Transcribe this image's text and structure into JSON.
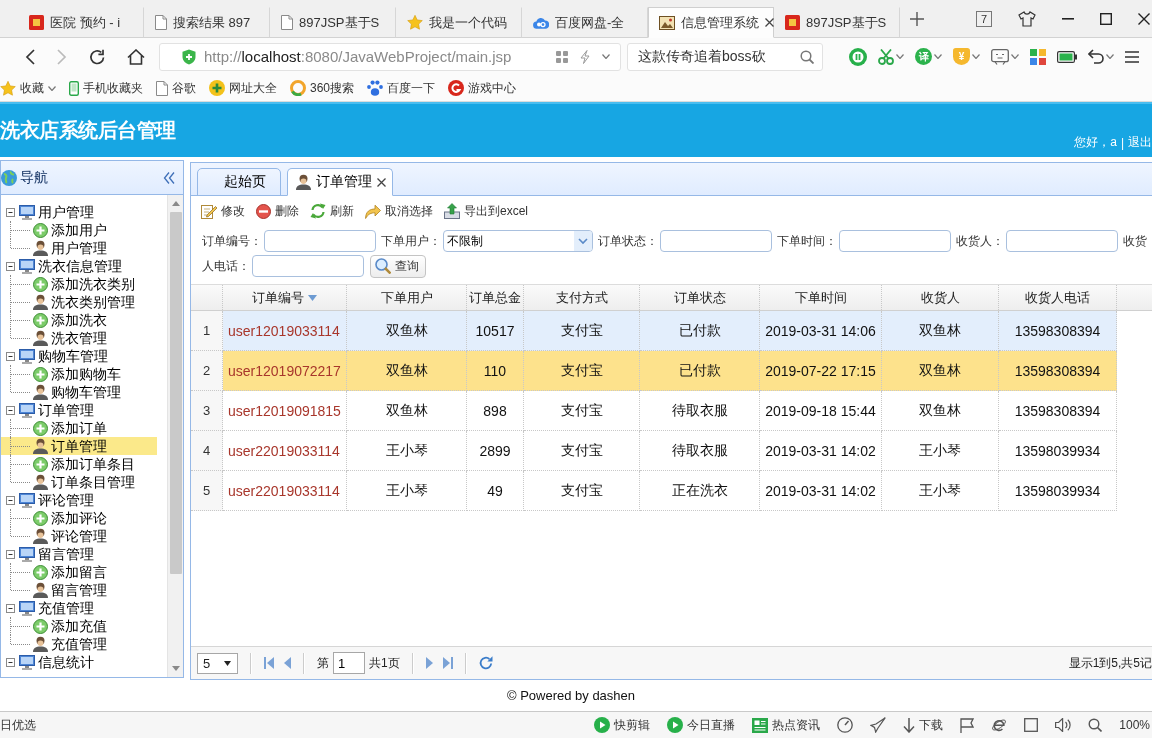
{
  "browser": {
    "tabs": [
      {
        "title": "医院 预约 - i",
        "kind": "site",
        "selected": false
      },
      {
        "title": "搜索结果 897",
        "kind": "page",
        "selected": false
      },
      {
        "title": "897JSP基于S",
        "kind": "page",
        "selected": false
      },
      {
        "title": "我是一个代码",
        "kind": "star",
        "selected": false
      },
      {
        "title": "百度网盘-全",
        "kind": "cloud",
        "selected": false
      },
      {
        "title": "信息管理系统",
        "kind": "picture",
        "selected": true
      },
      {
        "title": "897JSP基于S",
        "kind": "site",
        "selected": false
      }
    ],
    "tab_count": "7",
    "url": "http://**localhost**:8080/JavaWebProject/main.jsp",
    "search": "这款传奇追着boss砍",
    "extensions": [
      {
        "kind": "pause"
      },
      {
        "kind": "scissors"
      },
      {
        "kind": "translate",
        "label": "译"
      },
      {
        "kind": "shield",
        "label": "¥"
      },
      {
        "kind": "frame"
      },
      {
        "kind": "apps"
      },
      {
        "kind": "battery"
      },
      {
        "kind": "undo"
      },
      {
        "kind": "menu"
      }
    ],
    "bookmarks": [
      {
        "label": "收藏",
        "kind": "favorites"
      },
      {
        "label": "手机收藏夹",
        "kind": "phone"
      },
      {
        "label": "谷歌",
        "kind": "page"
      },
      {
        "label": "网址大全",
        "kind": "portal"
      },
      {
        "label": "360搜索",
        "kind": "ring"
      },
      {
        "label": "百度一下",
        "kind": "paw"
      },
      {
        "label": "游戏中心",
        "kind": "game"
      }
    ]
  },
  "app": {
    "title": "洗衣店系统后台管理",
    "greeting": "您好，a",
    "separator": "|",
    "logout": "退出",
    "sidebar": {
      "title": "导航",
      "tree": [
        {
          "label": "用户管理",
          "expanded": true,
          "children": [
            {
              "label": "添加用户",
              "kind": "add",
              "selected": false
            },
            {
              "label": "用户管理",
              "kind": "manage",
              "selected": false
            }
          ]
        },
        {
          "label": "洗衣信息管理",
          "expanded": true,
          "children": [
            {
              "label": "添加洗衣类别",
              "kind": "add",
              "selected": false
            },
            {
              "label": "洗衣类别管理",
              "kind": "manage",
              "selected": false
            },
            {
              "label": "添加洗衣",
              "kind": "add",
              "selected": false
            },
            {
              "label": "洗衣管理",
              "kind": "manage",
              "selected": false
            }
          ]
        },
        {
          "label": "购物车管理",
          "expanded": true,
          "children": [
            {
              "label": "添加购物车",
              "kind": "add",
              "selected": false
            },
            {
              "label": "购物车管理",
              "kind": "manage",
              "selected": false
            }
          ]
        },
        {
          "label": "订单管理",
          "expanded": true,
          "children": [
            {
              "label": "添加订单",
              "kind": "add",
              "selected": false
            },
            {
              "label": "订单管理",
              "kind": "manage",
              "selected": true
            },
            {
              "label": "添加订单条目",
              "kind": "add",
              "selected": false
            },
            {
              "label": "订单条目管理",
              "kind": "manage",
              "selected": false
            }
          ]
        },
        {
          "label": "评论管理",
          "expanded": true,
          "children": [
            {
              "label": "添加评论",
              "kind": "add",
              "selected": false
            },
            {
              "label": "评论管理",
              "kind": "manage",
              "selected": false
            }
          ]
        },
        {
          "label": "留言管理",
          "expanded": true,
          "children": [
            {
              "label": "添加留言",
              "kind": "add",
              "selected": false
            },
            {
              "label": "留言管理",
              "kind": "manage",
              "selected": false
            }
          ]
        },
        {
          "label": "充值管理",
          "expanded": true,
          "children": [
            {
              "label": "添加充值",
              "kind": "add",
              "selected": false
            },
            {
              "label": "充值管理",
              "kind": "manage",
              "selected": false
            }
          ]
        },
        {
          "label": "信息统计",
          "expanded": true
        }
      ]
    },
    "tabs": [
      {
        "label": "起始页",
        "kind": "plain",
        "selected": false,
        "closable": false
      },
      {
        "label": "订单管理",
        "kind": "manage",
        "selected": true,
        "closable": true
      }
    ],
    "toolbar": [
      {
        "label": "修改",
        "kind": "edit"
      },
      {
        "label": "删除",
        "kind": "delete"
      },
      {
        "label": "刷新",
        "kind": "refresh"
      },
      {
        "label": "取消选择",
        "kind": "undo"
      },
      {
        "label": "导出到excel",
        "kind": "export"
      }
    ],
    "search_rows": [
      [
        {
          "kind": "label",
          "text": "订单编号："
        },
        {
          "kind": "input"
        },
        {
          "kind": "label",
          "text": "下单用户："
        },
        {
          "kind": "select",
          "value": "不限制"
        },
        {
          "kind": "label",
          "text": "订单状态："
        },
        {
          "kind": "input"
        },
        {
          "kind": "label",
          "text": "下单时间："
        },
        {
          "kind": "input"
        },
        {
          "kind": "label",
          "text": "收货人："
        },
        {
          "kind": "input"
        },
        {
          "kind": "label",
          "text": "收货"
        }
      ],
      [
        {
          "kind": "label",
          "text": "人电话："
        },
        {
          "kind": "input"
        },
        {
          "kind": "button",
          "text": "查询"
        }
      ]
    ],
    "grid": {
      "columns": [
        {
          "label": "订单编号",
          "sorted": true
        },
        {
          "label": "下单用户",
          "sorted": false
        },
        {
          "label": "订单总金",
          "sorted": false
        },
        {
          "label": "支付方式",
          "sorted": false
        },
        {
          "label": "订单状态",
          "sorted": false
        },
        {
          "label": "下单时间",
          "sorted": false
        },
        {
          "label": "收货人",
          "sorted": false
        },
        {
          "label": "收货人电话",
          "sorted": false
        }
      ],
      "rows": [
        {
          "number": "1",
          "selected": false,
          "hovered": true,
          "cells": [
            "user12019033114",
            "双鱼林",
            "10517",
            "支付宝",
            "已付款",
            "2019-03-31 14:06",
            "双鱼林",
            "13598308394"
          ]
        },
        {
          "number": "2",
          "selected": true,
          "hovered": false,
          "cells": [
            "user12019072217",
            "双鱼林",
            "110",
            "支付宝",
            "已付款",
            "2019-07-22 17:15",
            "双鱼林",
            "13598308394"
          ]
        },
        {
          "number": "3",
          "selected": false,
          "hovered": false,
          "cells": [
            "user12019091815",
            "双鱼林",
            "898",
            "支付宝",
            "待取衣服",
            "2019-09-18 15:44",
            "双鱼林",
            "13598308394"
          ]
        },
        {
          "number": "4",
          "selected": false,
          "hovered": false,
          "cells": [
            "user22019033114",
            "王小琴",
            "2899",
            "支付宝",
            "待取衣服",
            "2019-03-31 14:02",
            "王小琴",
            "13598039934"
          ]
        },
        {
          "number": "5",
          "selected": false,
          "hovered": false,
          "cells": [
            "user22019033114",
            "王小琴",
            "49",
            "支付宝",
            "正在洗衣",
            "2019-03-31 14:02",
            "王小琴",
            "13598039934"
          ]
        }
      ]
    },
    "pager": {
      "page_size": "5",
      "page_prefix": "第",
      "page": "1",
      "page_suffix": "共1页",
      "summary": "显示1到5,共5记"
    },
    "footer": "© Powered by dashen"
  },
  "status_bar": {
    "left": "日优选",
    "items": [
      {
        "label": "快剪辑",
        "kind": "play"
      },
      {
        "label": "今日直播",
        "kind": "play"
      },
      {
        "label": "热点资讯",
        "kind": "news"
      },
      {
        "kind": "gauge"
      },
      {
        "kind": "plane"
      },
      {
        "label": "下载",
        "kind": "download"
      },
      {
        "kind": "flag"
      },
      {
        "kind": "browser"
      },
      {
        "kind": "window"
      },
      {
        "kind": "speaker"
      },
      {
        "kind": "zoom"
      }
    ],
    "zoom": "100%"
  }
}
